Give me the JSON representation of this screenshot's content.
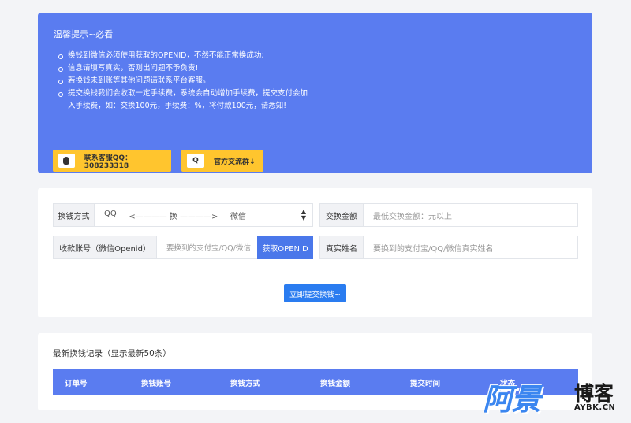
{
  "notice": {
    "title": "温馨提示~必看",
    "items": [
      "换钱到微信必须使用获取的OPENID，不然不能正常换成功;",
      "信息请填写真实，否则出问题不予负责!",
      "若换钱未到账等其他问题请联系平台客服。",
      "提交换钱我们会收取一定手续费，系统会自动增加手续费，提交支付会加入手续费，如：交换100元，手续费：%，将付款100元，请悉知!"
    ],
    "qq_button": "联系客服QQ：308233318",
    "group_button": "官方交流群↓",
    "qq_icon": "qq-penguin-icon",
    "group_icon_letter": "Q"
  },
  "form": {
    "method_label": "换钱方式",
    "method_from": "QQ",
    "method_arrow": "<———— 换 ————>",
    "method_to": "微信",
    "amount_label": "交换金额",
    "amount_placeholder": "最低交换金额：元以上",
    "account_label": "收款账号（微信Openid）",
    "account_placeholder": "要换到的支付宝/QQ/微信",
    "fetch_button": "获取OPENID",
    "name_label": "真实姓名",
    "name_placeholder": "要换到的支付宝/QQ/微信真实姓名",
    "submit_button": "立即提交换钱~"
  },
  "records": {
    "title": "最新换钱记录（显示最新50条）",
    "columns": [
      "订单号",
      "换钱账号",
      "换钱方式",
      "换钱金额",
      "提交时间",
      "状态"
    ]
  },
  "watermark": {
    "big": "阿景",
    "blog": "博客",
    "url": "AYBK.CN"
  },
  "colors": {
    "notice_bg": "#5a7cf0",
    "button_yellow": "#ffc52e",
    "primary_blue": "#2a7cf0"
  }
}
